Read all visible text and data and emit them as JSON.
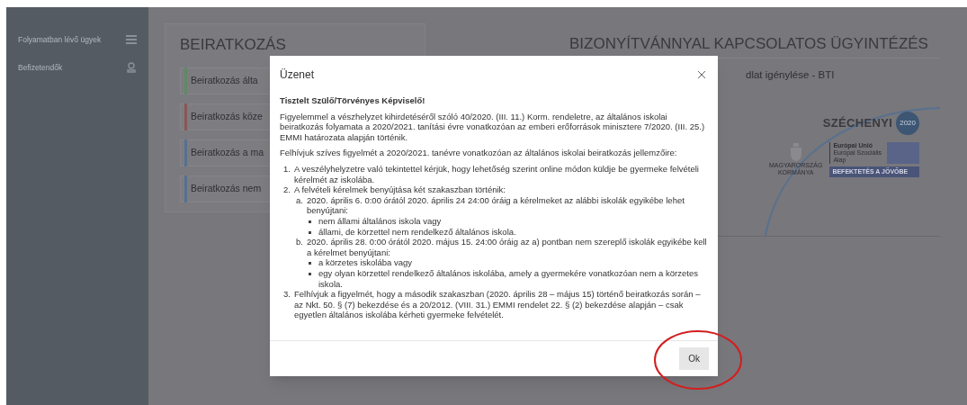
{
  "sidebar": {
    "items": [
      {
        "label": "Folyamatban lévő ügyek"
      },
      {
        "label": "Befizetendők"
      }
    ]
  },
  "enrollment": {
    "title": "BEIRATKOZÁS",
    "items": [
      {
        "label": "Beiratkozás álta",
        "color": "#5f8a63"
      },
      {
        "label": "Beiratkozás köze",
        "color": "#8a5656"
      },
      {
        "label": "Beiratkozás a ma",
        "color": "#56718f"
      },
      {
        "label": "Beiratkozás nem",
        "color": "#56718f"
      }
    ]
  },
  "certificates": {
    "title": "BIZONYÍTVÁNNYAL KAPCSOLATOS ÜGYINTÉZÉS",
    "items": [
      {
        "label": "dlat igénylése - BTI"
      }
    ]
  },
  "logo": {
    "brand": "SZÉCHENYI",
    "year": "2020",
    "eu_lines": [
      "Európai Unió",
      "Európai Szociális",
      "Alap"
    ],
    "gov_lines": [
      "MAGYARORSZÁG",
      "KORMÁNYA"
    ],
    "slogan": "BEFEKTETÉS A JÖVŐBE"
  },
  "modal": {
    "title": "Üzenet",
    "greeting": "Tisztelt Szülő/Törvényes Képviselő!",
    "paragraphs": [
      "Figyelemmel a vészhelyzet kihirdetéséről szóló 40/2020. (III. 11.) Korm. rendeletre, az általános iskolai beiratkozás folyamata a 2020/2021. tanítási évre vonatkozóan az emberi erőforrások minisztere 7/2020. (III. 25.) EMMI határozata alapján történik.",
      "Felhívjuk szíves figyelmét a 2020/2021. tanévre vonatkozóan az általános iskolai beiratkozás jellemzőire:"
    ],
    "list": [
      {
        "marker": "1.",
        "text": "A veszélyhelyzetre való tekintettel kérjük, hogy lehetőség szerint online módon küldje be gyermeke felvételi kérelmét az iskolába."
      },
      {
        "marker": "2.",
        "text": "A felvételi kérelmek benyújtása két szakaszban történik:",
        "children": [
          {
            "marker": "a.",
            "text": "2020. április 6. 0:00 órától 2020. április 24 24:00 óráig a kérelmeket az alábbi iskolák egyikébe lehet benyújtani:",
            "children": [
              {
                "text": "nem állami általános iskola vagy"
              },
              {
                "text": "állami, de körzettel nem rendelkező általános iskola."
              }
            ]
          },
          {
            "marker": "b.",
            "text": "2020. április 28. 0:00 órától 2020. május 15. 24:00 óráig az a) pontban nem szereplő iskolák egyikébe kell a kérelmet benyújtani:",
            "children": [
              {
                "text": "a körzetes iskolába vagy"
              },
              {
                "text": "egy olyan körzettel rendelkező általános iskolába, amely a gyermekére vonatkozóan nem a körzetes iskola."
              }
            ]
          }
        ]
      },
      {
        "marker": "3.",
        "text": "Felhívjuk a figyelmét, hogy a második szakaszban (2020. április 28 – május 15) történő beiratkozás során – az Nkt. 50. § (7) bekezdése és a 20/2012. (VIII. 31.) EMMI rendelet 22. § (2) bekezdése alapján – csak egyetlen általános iskolába kérheti gyermeke felvételét."
      }
    ],
    "button": "Ok"
  }
}
